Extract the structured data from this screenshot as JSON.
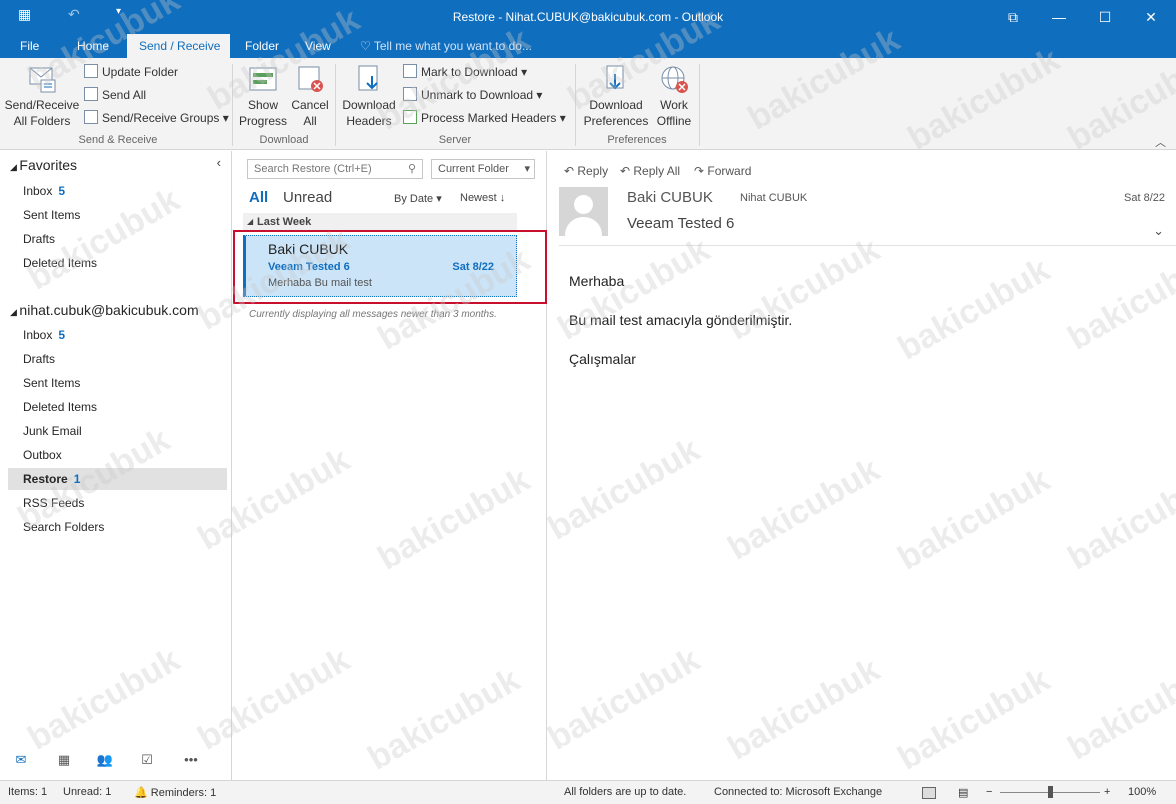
{
  "window": {
    "title": "Restore - Nihat.CUBUK@bakicubuk.com - Outlook",
    "controls": [
      "ribbon-display-icon",
      "minimize-icon",
      "maximize-icon",
      "close-icon"
    ]
  },
  "quick_access": [
    "app-icon",
    "undo-icon",
    "customize-icon"
  ],
  "tabs": [
    "File",
    "Home",
    "Send / Receive",
    "Folder",
    "View"
  ],
  "active_tab": "Send / Receive",
  "tell_me": "Tell me what you want to do...",
  "ribbon": {
    "send_receive_all": "Send/Receive\nAll Folders",
    "update_folder": "Update Folder",
    "send_all": "Send All",
    "send_receive_groups": "Send/Receive Groups",
    "group_send_receive": "Send & Receive",
    "show_progress": "Show\nProgress",
    "cancel_all": "Cancel\nAll",
    "group_download": "Download",
    "download_headers": "Download\nHeaders",
    "mark_to_download": "Mark to Download",
    "unmark_to_download": "Unmark to Download",
    "process_marked": "Process Marked Headers",
    "group_server": "Server",
    "download_preferences": "Download\nPreferences",
    "work_offline": "Work\nOffline",
    "group_preferences": "Preferences"
  },
  "nav": {
    "favorites_label": "Favorites",
    "favorites": [
      {
        "label": "Inbox",
        "count": "5"
      },
      {
        "label": "Sent Items",
        "count": ""
      },
      {
        "label": "Drafts",
        "count": ""
      },
      {
        "label": "Deleted Items",
        "count": ""
      }
    ],
    "account_label": "nihat.cubuk@bakicubuk.com",
    "folders": [
      {
        "label": "Inbox",
        "count": "5"
      },
      {
        "label": "Drafts",
        "count": ""
      },
      {
        "label": "Sent Items",
        "count": ""
      },
      {
        "label": "Deleted Items",
        "count": ""
      },
      {
        "label": "Junk Email",
        "count": ""
      },
      {
        "label": "Outbox",
        "count": ""
      },
      {
        "label": "Restore",
        "count": "1"
      },
      {
        "label": "RSS Feeds",
        "count": ""
      },
      {
        "label": "Search Folders",
        "count": ""
      }
    ],
    "selected_folder": "Restore"
  },
  "list": {
    "search_placeholder": "Search Restore (Ctrl+E)",
    "scope": "Current Folder",
    "filter_all": "All",
    "filter_unread": "Unread",
    "sort_by": "By Date",
    "order": "Newest",
    "group_header": "Last Week",
    "message": {
      "from": "Baki CUBUK",
      "subject": "Veeam Tested 6",
      "date": "Sat 8/22",
      "preview": "Merhaba  Bu mail test"
    },
    "note": "Currently displaying all messages newer than 3 months."
  },
  "reading": {
    "reply": "Reply",
    "reply_all": "Reply All",
    "forward": "Forward",
    "from": "Baki CUBUK",
    "to": "Nihat CUBUK",
    "date": "Sat 8/22",
    "subject": "Veeam Tested 6",
    "body": [
      "Merhaba",
      "Bu mail test amacıyla gönderilmiştir.",
      "Çalışmalar"
    ]
  },
  "status": {
    "items": "Items: 1",
    "unread": "Unread: 1",
    "reminders": "Reminders: 1",
    "sync": "All folders are up to date.",
    "connection": "Connected to: Microsoft Exchange",
    "zoom": "100%"
  },
  "watermark": "bakicubuk",
  "colors": {
    "accent": "#106ebe",
    "highlight": "#cce4f7",
    "callout": "#c8102e"
  }
}
